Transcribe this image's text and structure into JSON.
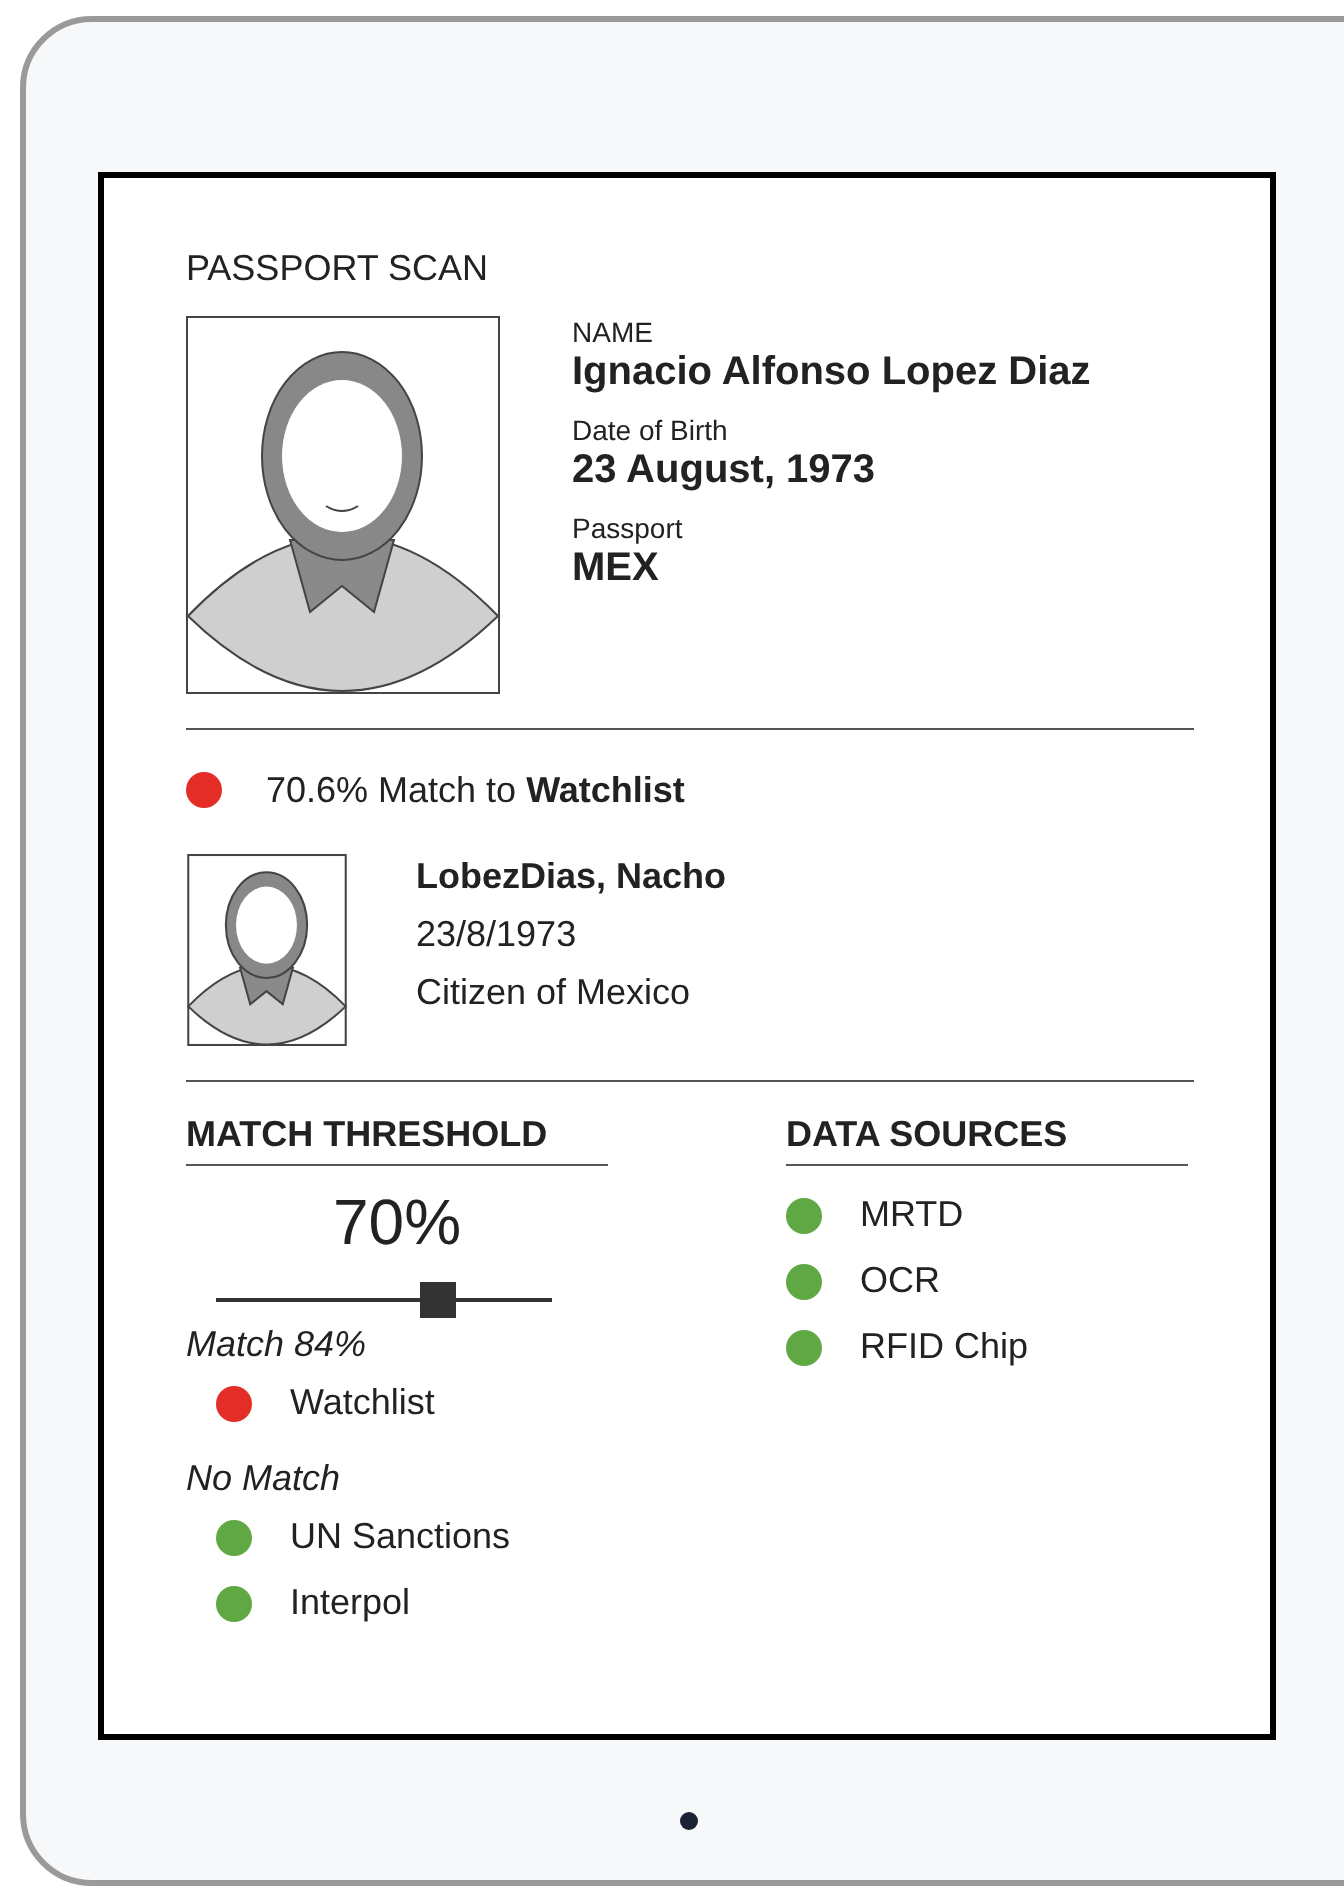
{
  "screen": {
    "title": "PASSPORT SCAN"
  },
  "passport": {
    "fields": [
      {
        "label": "NAME",
        "value": "Ignacio Alfonso Lopez Diaz"
      },
      {
        "label": "Date of Birth",
        "value": "23 August, 1973"
      },
      {
        "label": "Passport",
        "value": "MEX"
      }
    ]
  },
  "match": {
    "color": "#e52d27",
    "text": "70.6% Match to **Watchlist**"
  },
  "candidate": {
    "name": "LobezDias, Nacho",
    "lines": [
      "23/8/1973",
      "Citizen of Mexico"
    ]
  },
  "threshold": {
    "heading": "MATCH THRESHOLD",
    "reading": "70%",
    "level": 0.66,
    "groups": [
      {
        "label": "Match 84%",
        "items": [
          {
            "name": "Watchlist",
            "color": "#e52d27"
          }
        ]
      },
      {
        "label": "No Match",
        "items": [
          {
            "name": "UN Sanctions",
            "color": "#5fa843"
          },
          {
            "name": "Interpol",
            "color": "#5fa843"
          }
        ]
      }
    ]
  },
  "data_sources": {
    "heading": "DATA SOURCES",
    "items": [
      {
        "name": "MRTD",
        "color": "#5fa843"
      },
      {
        "name": "OCR",
        "color": "#5fa843"
      },
      {
        "name": "RFID Chip",
        "color": "#5fa843"
      }
    ]
  }
}
